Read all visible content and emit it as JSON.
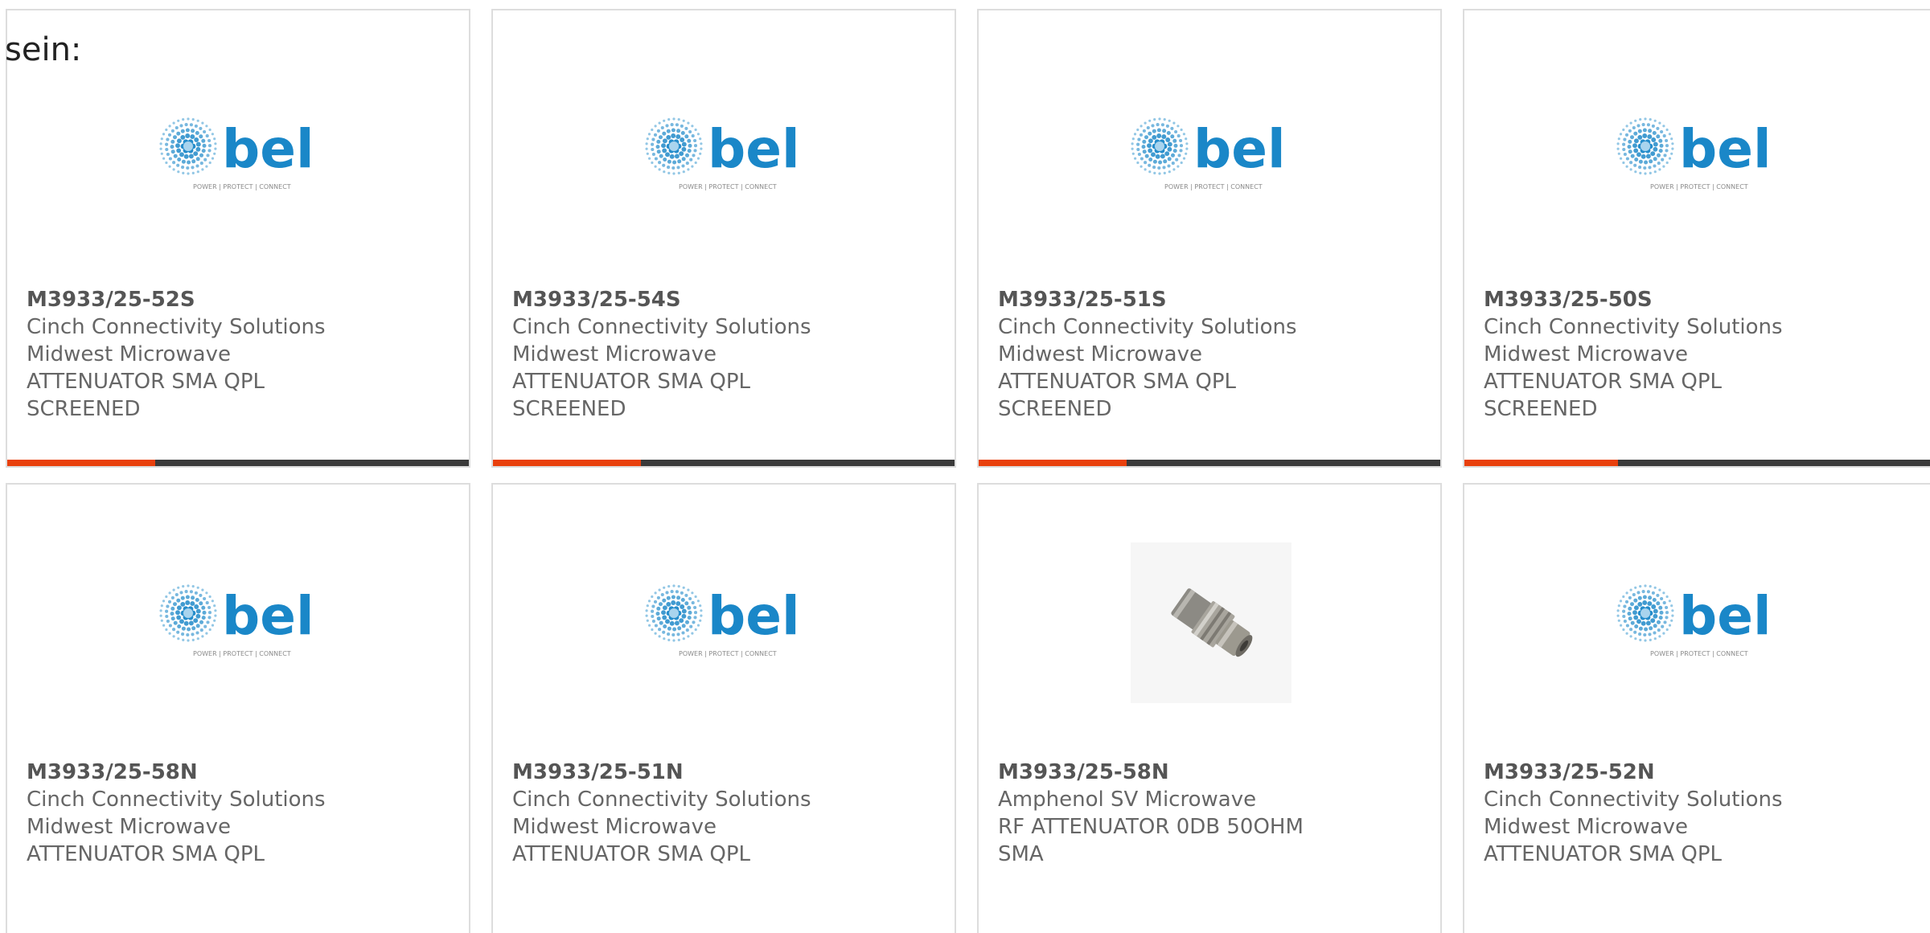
{
  "heading": "sein:",
  "colors": {
    "accent": "#e8400c",
    "bar": "#3a3a3a",
    "bel_blue": "#1a87c8",
    "text": "#666666",
    "border": "#dddddd"
  },
  "logo": {
    "text": "bel",
    "tagline": "POWER | PROTECT | CONNECT"
  },
  "row1": [
    {
      "part": "M3933/25-52S",
      "manufacturer": "Cinch Connectivity Solutions",
      "sub": "Midwest Microwave",
      "desc1": "ATTENUATOR SMA QPL",
      "desc2": "SCREENED",
      "image": "bel-logo",
      "progress": 0.32
    },
    {
      "part": "M3933/25-54S",
      "manufacturer": "Cinch Connectivity Solutions",
      "sub": "Midwest Microwave",
      "desc1": "ATTENUATOR SMA QPL",
      "desc2": "SCREENED",
      "image": "bel-logo",
      "progress": 0.32
    },
    {
      "part": "M3933/25-51S",
      "manufacturer": "Cinch Connectivity Solutions",
      "sub": "Midwest Microwave",
      "desc1": "ATTENUATOR SMA QPL",
      "desc2": "SCREENED",
      "image": "bel-logo",
      "progress": 0.32
    },
    {
      "part": "M3933/25-50S",
      "manufacturer": "Cinch Connectivity Solutions",
      "sub": "Midwest Microwave",
      "desc1": "ATTENUATOR SMA QPL",
      "desc2": "SCREENED",
      "image": "bel-logo",
      "progress": 0.32
    }
  ],
  "row2": [
    {
      "part": "M3933/25-58N",
      "manufacturer": "Cinch Connectivity Solutions",
      "sub": "Midwest Microwave",
      "desc1": "ATTENUATOR SMA QPL",
      "image": "bel-logo"
    },
    {
      "part": "M3933/25-51N",
      "manufacturer": "Cinch Connectivity Solutions",
      "sub": "Midwest Microwave",
      "desc1": "ATTENUATOR SMA QPL",
      "image": "bel-logo"
    },
    {
      "part": "M3933/25-58N",
      "manufacturer": "Amphenol SV Microwave",
      "desc1": "RF ATTENUATOR 0DB 50OHM",
      "desc2": "SMA",
      "image": "product-photo"
    },
    {
      "part": "M3933/25-52N",
      "manufacturer": "Cinch Connectivity Solutions",
      "sub": "Midwest Microwave",
      "desc1": "ATTENUATOR SMA QPL",
      "image": "bel-logo"
    }
  ]
}
